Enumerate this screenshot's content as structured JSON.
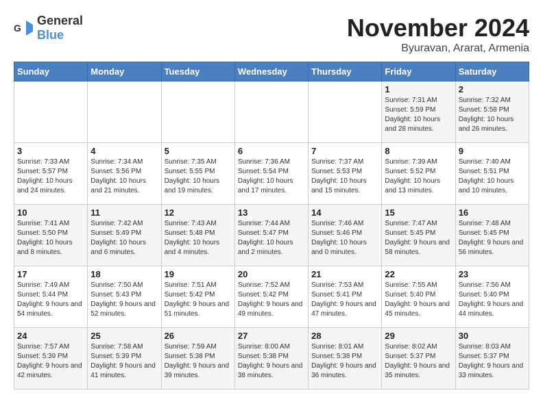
{
  "header": {
    "logo_general": "General",
    "logo_blue": "Blue",
    "month": "November 2024",
    "location": "Byuravan, Ararat, Armenia"
  },
  "weekdays": [
    "Sunday",
    "Monday",
    "Tuesday",
    "Wednesday",
    "Thursday",
    "Friday",
    "Saturday"
  ],
  "weeks": [
    [
      {
        "day": "",
        "info": ""
      },
      {
        "day": "",
        "info": ""
      },
      {
        "day": "",
        "info": ""
      },
      {
        "day": "",
        "info": ""
      },
      {
        "day": "",
        "info": ""
      },
      {
        "day": "1",
        "info": "Sunrise: 7:31 AM\nSunset: 5:59 PM\nDaylight: 10 hours and 28 minutes."
      },
      {
        "day": "2",
        "info": "Sunrise: 7:32 AM\nSunset: 5:58 PM\nDaylight: 10 hours and 26 minutes."
      }
    ],
    [
      {
        "day": "3",
        "info": "Sunrise: 7:33 AM\nSunset: 5:57 PM\nDaylight: 10 hours and 24 minutes."
      },
      {
        "day": "4",
        "info": "Sunrise: 7:34 AM\nSunset: 5:56 PM\nDaylight: 10 hours and 21 minutes."
      },
      {
        "day": "5",
        "info": "Sunrise: 7:35 AM\nSunset: 5:55 PM\nDaylight: 10 hours and 19 minutes."
      },
      {
        "day": "6",
        "info": "Sunrise: 7:36 AM\nSunset: 5:54 PM\nDaylight: 10 hours and 17 minutes."
      },
      {
        "day": "7",
        "info": "Sunrise: 7:37 AM\nSunset: 5:53 PM\nDaylight: 10 hours and 15 minutes."
      },
      {
        "day": "8",
        "info": "Sunrise: 7:39 AM\nSunset: 5:52 PM\nDaylight: 10 hours and 13 minutes."
      },
      {
        "day": "9",
        "info": "Sunrise: 7:40 AM\nSunset: 5:51 PM\nDaylight: 10 hours and 10 minutes."
      }
    ],
    [
      {
        "day": "10",
        "info": "Sunrise: 7:41 AM\nSunset: 5:50 PM\nDaylight: 10 hours and 8 minutes."
      },
      {
        "day": "11",
        "info": "Sunrise: 7:42 AM\nSunset: 5:49 PM\nDaylight: 10 hours and 6 minutes."
      },
      {
        "day": "12",
        "info": "Sunrise: 7:43 AM\nSunset: 5:48 PM\nDaylight: 10 hours and 4 minutes."
      },
      {
        "day": "13",
        "info": "Sunrise: 7:44 AM\nSunset: 5:47 PM\nDaylight: 10 hours and 2 minutes."
      },
      {
        "day": "14",
        "info": "Sunrise: 7:46 AM\nSunset: 5:46 PM\nDaylight: 10 hours and 0 minutes."
      },
      {
        "day": "15",
        "info": "Sunrise: 7:47 AM\nSunset: 5:45 PM\nDaylight: 9 hours and 58 minutes."
      },
      {
        "day": "16",
        "info": "Sunrise: 7:48 AM\nSunset: 5:45 PM\nDaylight: 9 hours and 56 minutes."
      }
    ],
    [
      {
        "day": "17",
        "info": "Sunrise: 7:49 AM\nSunset: 5:44 PM\nDaylight: 9 hours and 54 minutes."
      },
      {
        "day": "18",
        "info": "Sunrise: 7:50 AM\nSunset: 5:43 PM\nDaylight: 9 hours and 52 minutes."
      },
      {
        "day": "19",
        "info": "Sunrise: 7:51 AM\nSunset: 5:42 PM\nDaylight: 9 hours and 51 minutes."
      },
      {
        "day": "20",
        "info": "Sunrise: 7:52 AM\nSunset: 5:42 PM\nDaylight: 9 hours and 49 minutes."
      },
      {
        "day": "21",
        "info": "Sunrise: 7:53 AM\nSunset: 5:41 PM\nDaylight: 9 hours and 47 minutes."
      },
      {
        "day": "22",
        "info": "Sunrise: 7:55 AM\nSunset: 5:40 PM\nDaylight: 9 hours and 45 minutes."
      },
      {
        "day": "23",
        "info": "Sunrise: 7:56 AM\nSunset: 5:40 PM\nDaylight: 9 hours and 44 minutes."
      }
    ],
    [
      {
        "day": "24",
        "info": "Sunrise: 7:57 AM\nSunset: 5:39 PM\nDaylight: 9 hours and 42 minutes."
      },
      {
        "day": "25",
        "info": "Sunrise: 7:58 AM\nSunset: 5:39 PM\nDaylight: 9 hours and 41 minutes."
      },
      {
        "day": "26",
        "info": "Sunrise: 7:59 AM\nSunset: 5:38 PM\nDaylight: 9 hours and 39 minutes."
      },
      {
        "day": "27",
        "info": "Sunrise: 8:00 AM\nSunset: 5:38 PM\nDaylight: 9 hours and 38 minutes."
      },
      {
        "day": "28",
        "info": "Sunrise: 8:01 AM\nSunset: 5:38 PM\nDaylight: 9 hours and 36 minutes."
      },
      {
        "day": "29",
        "info": "Sunrise: 8:02 AM\nSunset: 5:37 PM\nDaylight: 9 hours and 35 minutes."
      },
      {
        "day": "30",
        "info": "Sunrise: 8:03 AM\nSunset: 5:37 PM\nDaylight: 9 hours and 33 minutes."
      }
    ]
  ]
}
